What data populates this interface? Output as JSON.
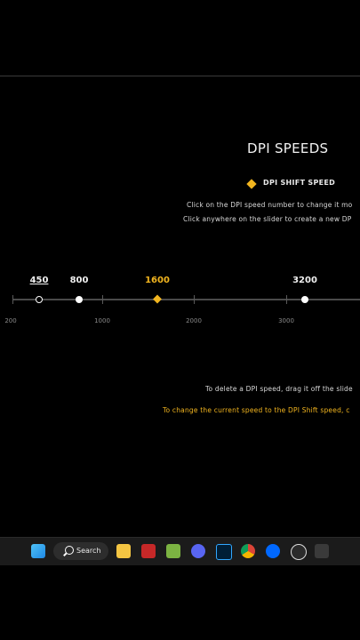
{
  "title": "DPI SPEEDS",
  "shift_legend": {
    "label": "DPI SHIFT SPEED",
    "color": "#f2b51f"
  },
  "instructions": {
    "line1": "Click on the DPI speed number to change it mo",
    "line2": "Click anywhere on the slider to create a new DP",
    "delete_hint": "To delete a DPI speed, drag it off the slide",
    "shift_hint": "To change the current speed to the DPI Shift speed, c"
  },
  "slider": {
    "dpi_speeds": [
      {
        "value": "450",
        "active": true
      },
      {
        "value": "800",
        "active": false
      },
      {
        "value": "1600",
        "shift": true
      },
      {
        "value": "3200",
        "active": false
      }
    ],
    "scale_labels": [
      "200",
      "1000",
      "2000",
      "3000"
    ]
  },
  "taskbar": {
    "search_label": "Search",
    "apps": [
      "windows-start",
      "file-explorer",
      "app-red",
      "app-green",
      "discord",
      "photoshop",
      "chrome",
      "zalo",
      "obs",
      "logitech-g-hub"
    ]
  },
  "colors": {
    "accent": "#f2b51f",
    "background": "#000000",
    "taskbar": "#1b1b1b"
  }
}
